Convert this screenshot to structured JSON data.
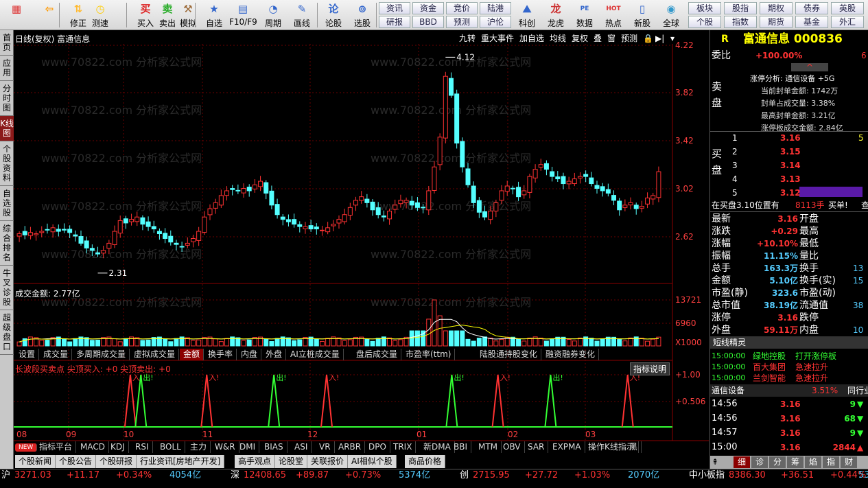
{
  "toolbar": {
    "buttons": [
      {
        "label": "",
        "icon": "home-grid-icon"
      },
      {
        "label": "",
        "icon": "back-arrow-icon"
      },
      {
        "label": "修正",
        "icon": "updown-icon"
      },
      {
        "label": "测速",
        "icon": "speed-icon"
      },
      {
        "label": "买入",
        "icon": "buy-icon"
      },
      {
        "label": "卖出",
        "icon": "sell-icon"
      },
      {
        "label": "模拟",
        "icon": "gavel-icon"
      },
      {
        "label": "自选",
        "icon": "star-icon"
      },
      {
        "label": "F10/F9",
        "icon": "f10-icon"
      },
      {
        "label": "周期",
        "icon": "cycle-icon"
      },
      {
        "label": "画线",
        "icon": "pen-icon"
      },
      {
        "label": "论股",
        "icon": "talk-icon"
      },
      {
        "label": "选股",
        "icon": "pick-icon"
      }
    ],
    "menu": [
      [
        "资讯",
        "资金",
        "竞价",
        "陆港"
      ],
      [
        "研报",
        "BBD",
        "预测",
        "沪伦"
      ]
    ],
    "buttons2": [
      {
        "label": "科创",
        "icon": "chart-icon"
      },
      {
        "label": "龙虎",
        "icon": "dragon-icon"
      },
      {
        "label": "数据",
        "icon": "pe-icon"
      },
      {
        "label": "热点",
        "icon": "hot-icon"
      },
      {
        "label": "新股",
        "icon": "ipo-icon"
      },
      {
        "label": "全球",
        "icon": "globe-icon"
      }
    ],
    "menu2": [
      [
        "板块",
        "股指",
        "期权",
        "债券",
        "英股"
      ],
      [
        "个股",
        "指数",
        "期货",
        "基金",
        "外汇"
      ]
    ]
  },
  "sidebar": [
    "首页",
    "应用",
    "分时图",
    "K线图",
    "个股资料",
    "自选股",
    "综合排名",
    "牛叉诊股",
    "超级盘口"
  ],
  "chart": {
    "title": "日线(复权)  富通信息",
    "top_buttons": [
      "九转",
      "重大事件",
      "加自选",
      "均线",
      "复权",
      "叠",
      "窗",
      "预测"
    ],
    "price_axis": [
      "4.22",
      "3.82",
      "3.42",
      "3.02",
      "2.62"
    ],
    "high_label": "4.12",
    "low_label": "2.31",
    "volume_title": "成交金额: 2.77亿",
    "volume_axis": [
      "13721",
      "6960",
      "X1000"
    ],
    "panel_tabs": [
      "设置",
      "成交量",
      "多周期成交量",
      "虚拟成交量",
      "金额",
      "换手率",
      "内盘",
      "外盘",
      "AI立桩成交量",
      "盘后成交量",
      "市盈率(ttm)",
      "陆股通持股变化",
      "融资融券变化"
    ],
    "indicator_title": "长波段买卖点 尖顶买入: +0 尖顶卖出: +0",
    "indicator_help": "指标说明",
    "indicator_axis": [
      "+1.00",
      "+0.506"
    ],
    "signals": [
      {
        "x": 0.177,
        "t": "入"
      },
      {
        "x": 0.193,
        "t": "出"
      },
      {
        "x": 0.293,
        "t": "入"
      },
      {
        "x": 0.395,
        "t": "出"
      },
      {
        "x": 0.475,
        "t": "入"
      },
      {
        "x": 0.665,
        "t": "出"
      },
      {
        "x": 0.735,
        "t": "入"
      },
      {
        "x": 0.815,
        "t": "出"
      },
      {
        "x": 0.932,
        "t": "入"
      }
    ],
    "months": [
      "08",
      "09",
      "10",
      "11",
      "12",
      "01",
      "02",
      "03"
    ],
    "watermark": "www.70822.com   分析家公式网",
    "indicator_tabs": [
      "NEW",
      "指标平台",
      "MACD",
      "KDJ",
      "RSI",
      "BOLL",
      "主力",
      "W&R",
      "DMI",
      "BIAS",
      "ASI",
      "VR",
      "ARBR",
      "DPO",
      "TRIX",
      "新DMA",
      "BBI",
      "MTM",
      "OBV",
      "SAR",
      "EXPMA",
      "操作K线指示",
      "黑"
    ],
    "news_tabs": [
      "个股新闻",
      "个股公告",
      "个股研报",
      "行业资讯[房地产开发]",
      "高手观点",
      "论股堂",
      "关联报价",
      "AI相似个股",
      "商品价格"
    ]
  },
  "right": {
    "code_title": "富通信息 000836",
    "r_label": "R",
    "weibi_label": "委比",
    "weibi_value": "+100.00%",
    "weibi_extra": "6",
    "limit_analysis": [
      "涨停分析: 通信设备 +5G",
      "当前封单金额: 1742万",
      "封单占成交量: 3.38%",
      "最高封单金额: 3.21亿",
      "涨停板成交金额: 2.84亿"
    ],
    "sell_label": "卖盘",
    "buy_label": "买盘",
    "bids": [
      {
        "n": "1",
        "p": "3.16",
        "v": "5"
      },
      {
        "n": "2",
        "p": "3.15",
        "v": ""
      },
      {
        "n": "3",
        "p": "3.14",
        "v": ""
      },
      {
        "n": "4",
        "p": "3.13",
        "v": ""
      },
      {
        "n": "5",
        "p": "3.12",
        "v": ""
      }
    ],
    "buy_line": {
      "text": "在买盘3.10位置有",
      "qty": "8113手",
      "action": "买单!",
      "end": "查"
    },
    "stats": [
      {
        "l": "最新",
        "v": "3.16",
        "l2": "开盘",
        "v2": ""
      },
      {
        "l": "涨跌",
        "v": "+0.29",
        "l2": "最高",
        "v2": ""
      },
      {
        "l": "涨幅",
        "v": "+10.10%",
        "l2": "最低",
        "v2": ""
      },
      {
        "l": "振幅",
        "v": "11.15%",
        "l2": "量比",
        "v2": ""
      },
      {
        "l": "总手",
        "v": "163.3万",
        "l2": "换手",
        "v2": "13"
      },
      {
        "l": "金额",
        "v": "5.10亿",
        "l2": "换手(实)",
        "v2": "15"
      },
      {
        "l": "市盈(静)",
        "v": "323.6",
        "l2": "市盈(动)",
        "v2": ""
      },
      {
        "l": "总市值",
        "v": "38.19亿",
        "l2": "流通值",
        "v2": "38"
      },
      {
        "l": "涨停",
        "v": "3.16",
        "l2": "跌停",
        "v2": ""
      },
      {
        "l": "外盘",
        "v": "59.11万",
        "l2": "内盘",
        "v2": "10"
      }
    ],
    "short_title": "短线精灵",
    "short": [
      {
        "t": "15:00:00",
        "n": "绿地控股",
        "e": "打开涨停板"
      },
      {
        "t": "15:00:00",
        "n": "百大集团",
        "e": "急速拉升"
      },
      {
        "t": "15:00:00",
        "n": "兰剑智能",
        "e": "急速拉升"
      }
    ],
    "sector": {
      "name": "通信设备",
      "pct": "3.51%",
      "label": "同行业"
    },
    "ticks": [
      {
        "t": "14:56",
        "p": "3.16",
        "v": "9",
        "d": "down"
      },
      {
        "t": "14:56",
        "p": "3.16",
        "v": "68",
        "d": "down"
      },
      {
        "t": "14:57",
        "p": "3.16",
        "v": "9",
        "d": "down"
      },
      {
        "t": "15:00",
        "p": "3.16",
        "v": "2844",
        "d": "up"
      }
    ],
    "bottom_tabs": [
      "细",
      "诊",
      "分",
      "筹",
      "焰",
      "指",
      "财"
    ]
  },
  "status": [
    {
      "n": "沪",
      "v": "3271.03",
      "c": "+11.17",
      "p": "+0.34%",
      "a": "4054亿"
    },
    {
      "n": "深",
      "v": "12408.65",
      "c": "+89.87",
      "p": "+0.73%",
      "a": "5374亿"
    },
    {
      "n": "创",
      "v": "2715.95",
      "c": "+27.72",
      "p": "+1.03%",
      "a": "2070亿"
    },
    {
      "n": "中小板指",
      "v": "8386.30",
      "c": "+36.51",
      "p": "+0.44%",
      "a": "53"
    }
  ]
}
